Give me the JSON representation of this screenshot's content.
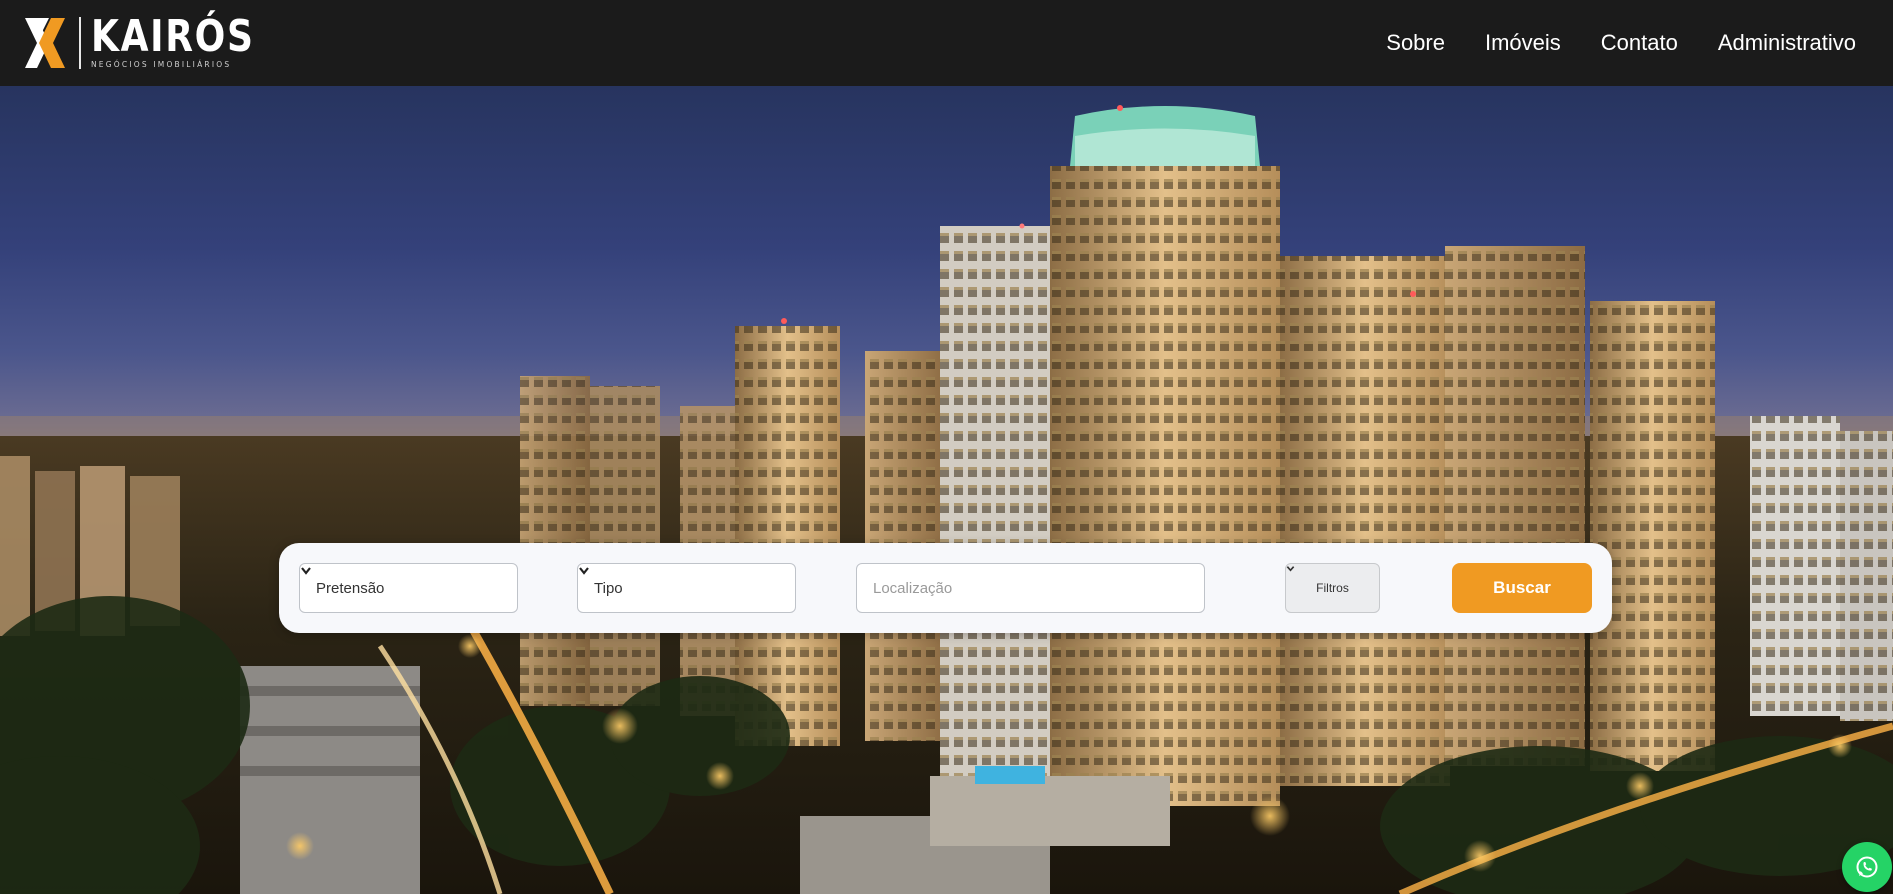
{
  "brand": {
    "name": "KAIRÓS",
    "tagline": "NEGÓCIOS IMOBILIÁRIOS",
    "accent": "#f09a22"
  },
  "nav": {
    "items": [
      {
        "label": "Sobre"
      },
      {
        "label": "Imóveis"
      },
      {
        "label": "Contato"
      },
      {
        "label": "Administrativo"
      }
    ]
  },
  "search": {
    "pretensao": "Pretensão",
    "tipo": "Tipo",
    "localizacao_placeholder": "Localização",
    "filtros_label": "Filtros",
    "buscar_label": "Buscar"
  },
  "icons": {
    "dropdown": "chevron-down-icon",
    "filtros": "chevron-down-icon",
    "floating": "whatsapp-icon"
  }
}
